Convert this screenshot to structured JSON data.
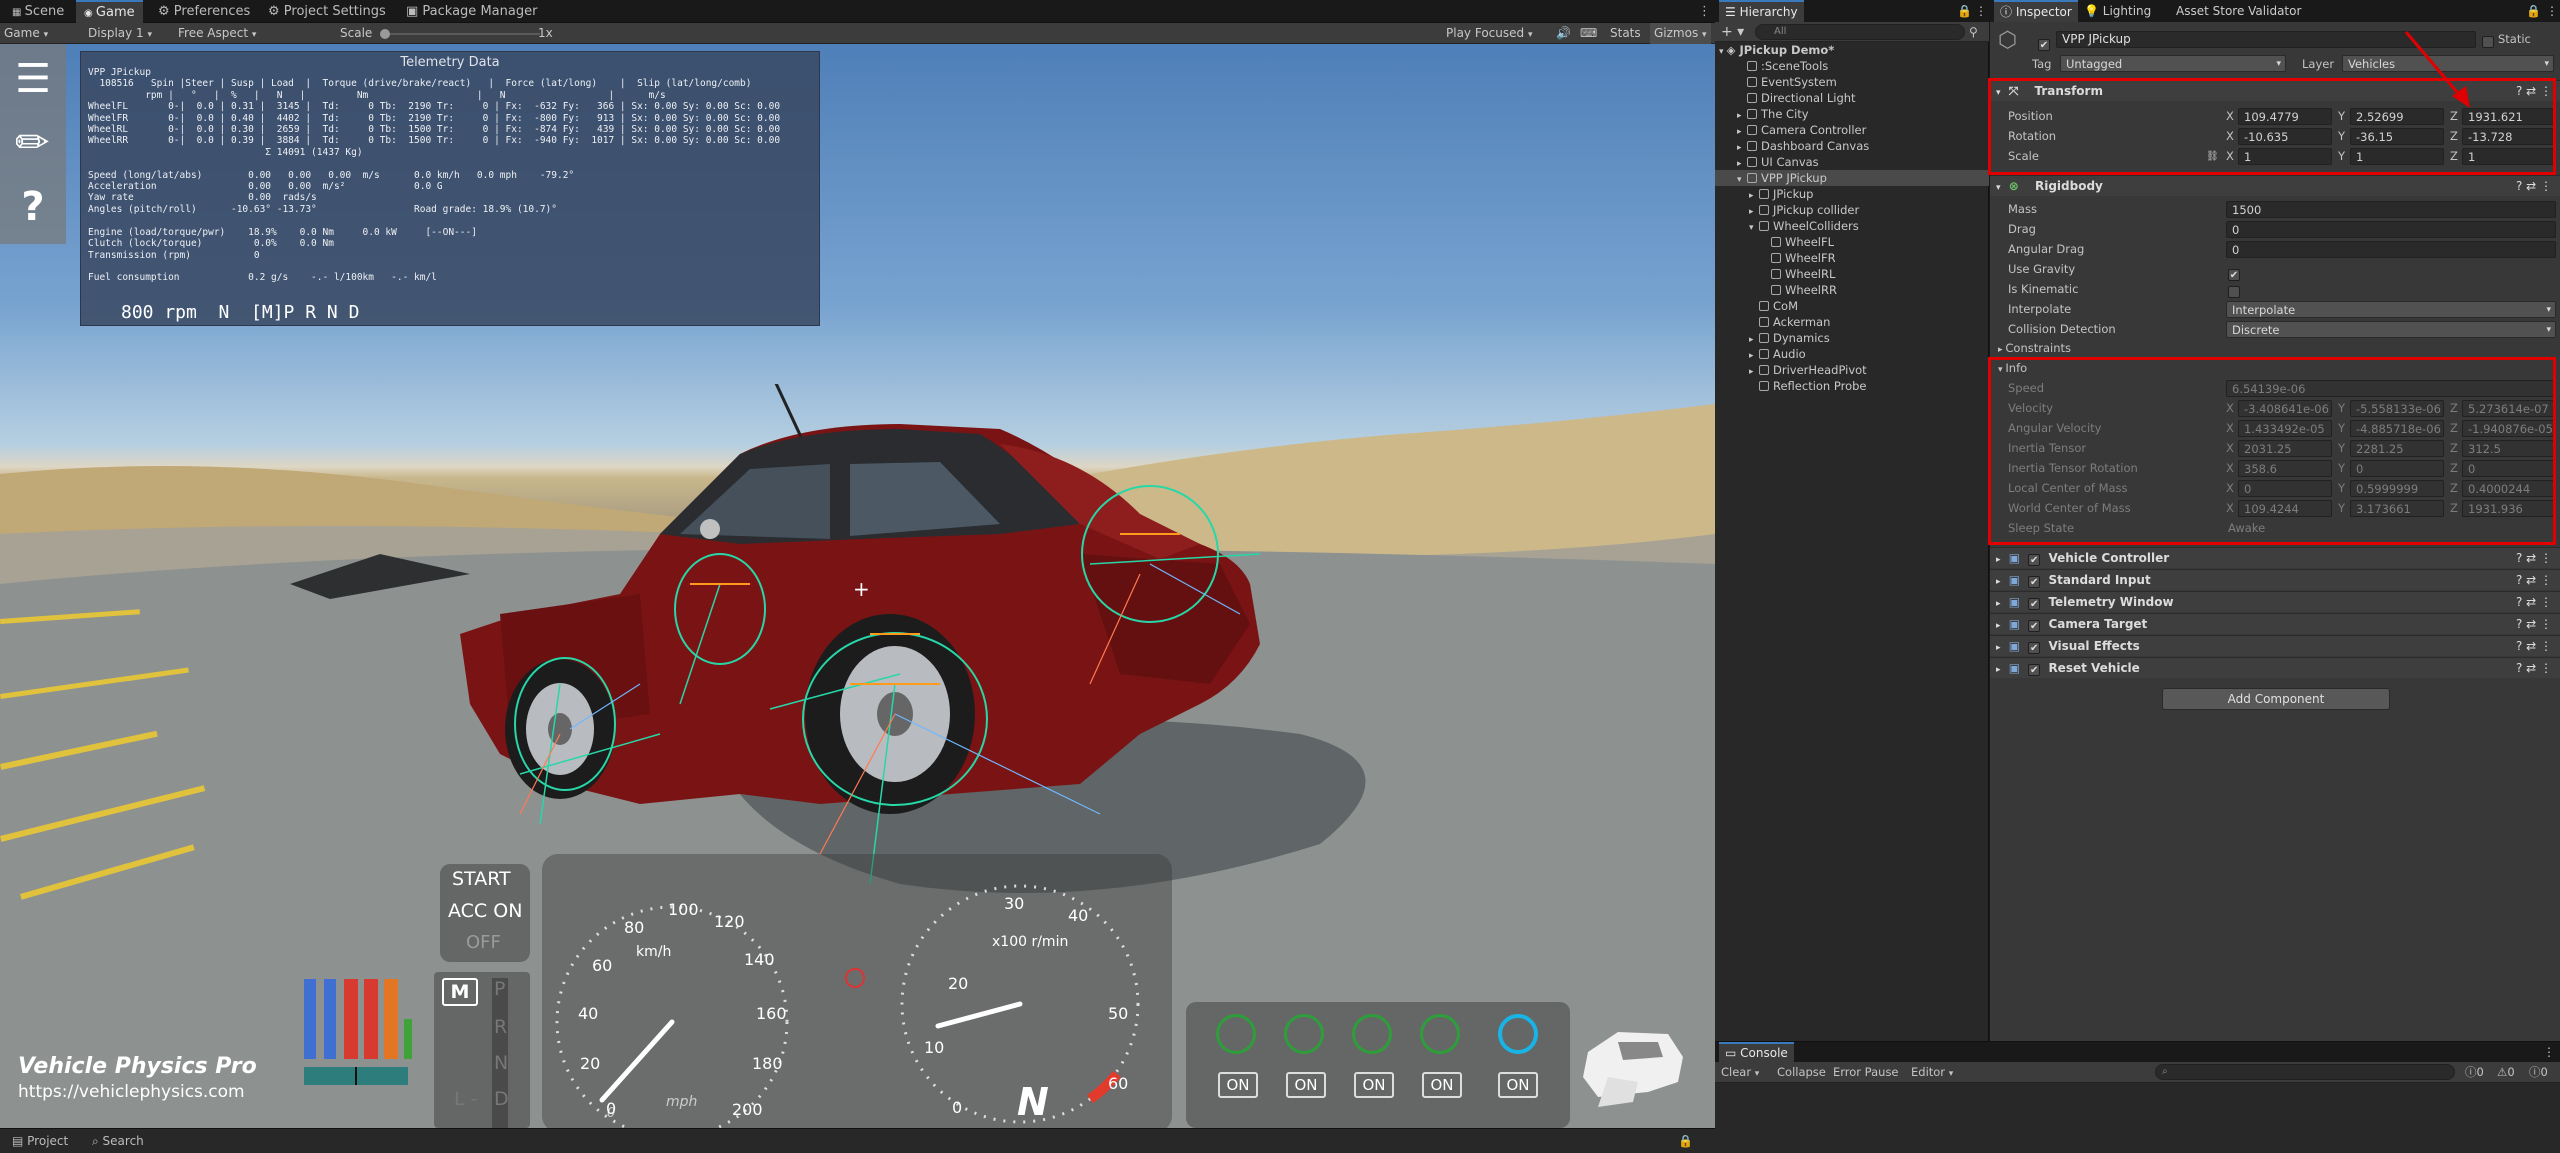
{
  "tabs": {
    "scene": "Scene",
    "game": "Game",
    "preferences": "Preferences",
    "project_settings": "Project Settings",
    "package_manager": "Package Manager"
  },
  "game_toolbar": {
    "game": "Game",
    "display": "Display 1",
    "aspect": "Free Aspect",
    "scale_label": "Scale",
    "scale_value": "1x",
    "play_mode": "Play Focused",
    "stats": "Stats",
    "gizmos": "Gizmos"
  },
  "telemetry": {
    "title": "Telemetry Data",
    "body": "VPP JPickup\n  108516   Spin |Steer | Susp | Load  |  Torque (drive/brake/react)   |  Force (lat/long)    |  Slip (lat/long/comb)\n          rpm |   °   |  %   |   N   |         Nm                   |   N                  |      m/s\nWheelFL       0-|  0.0 | 0.31 |  3145 |  Td:     0 Tb:  2190 Tr:     0 | Fx:  -632 Fy:   366 | Sx: 0.00 Sy: 0.00 Sc: 0.00\nWheelFR       0-|  0.0 | 0.40 |  4402 |  Td:     0 Tb:  2190 Tr:     0 | Fx:  -800 Fy:   913 | Sx: 0.00 Sy: 0.00 Sc: 0.00\nWheelRL       0-|  0.0 | 0.30 |  2659 |  Td:     0 Tb:  1500 Tr:     0 | Fx:  -874 Fy:   439 | Sx: 0.00 Sy: 0.00 Sc: 0.00\nWheelRR       0-|  0.0 | 0.39 |  3884 |  Td:     0 Tb:  1500 Tr:     0 | Fx:  -940 Fy:  1017 | Sx: 0.00 Sy: 0.00 Sc: 0.00\n                               Σ 14091 (1437 Kg)\n\nSpeed (long/lat/abs)        0.00   0.00   0.00  m/s      0.0 km/h   0.0 mph    -79.2°\nAcceleration                0.00   0.00  m/s²            0.0 G\nYaw rate                    0.00  rads/s\nAngles (pitch/roll)      -10.63° -13.73°                 Road grade: 18.9% (10.7)°\n\nEngine (load/torque/pwr)    18.9%    0.0 Nm     0.0 kW     [--ON---]\nClutch (lock/torque)         0.0%    0.0 Nm\nTransmission (rpm)           0\n\nFuel consumption            0.2 g/s    -.- l/100km   -.- km/l",
    "rpm_line": "800 rpm  N  [M]P R N D"
  },
  "hud": {
    "start": "START",
    "acc_on": "ACC ON",
    "off": "OFF",
    "gear_mode": "M",
    "gears": [
      "P",
      "R",
      "N",
      "D"
    ],
    "gear_l": "L -",
    "speedo_unit": "km/h",
    "speedo_labels": [
      "0",
      "20",
      "40",
      "60",
      "80",
      "100",
      "120",
      "140",
      "160",
      "180",
      "200"
    ],
    "speedo_mph": "0",
    "mph_label": "mph",
    "tacho_unit": "x100 r/min",
    "tacho_labels": [
      "0",
      "10",
      "20",
      "30",
      "40",
      "50",
      "60"
    ],
    "gear_display": "N",
    "assist_buttons": [
      "ON",
      "ON",
      "ON",
      "ON",
      "ON"
    ],
    "brand": "Vehicle Physics Pro",
    "url": "https://vehiclephysics.com"
  },
  "bottom_tabs": {
    "project": "Project",
    "search": "Search"
  },
  "hierarchy": {
    "tab": "Hierarchy",
    "search_placeholder": "All",
    "root": "JPickup Demo*",
    "items": [
      {
        "label": ":SceneTools",
        "indent": 1,
        "fold": ""
      },
      {
        "label": "EventSystem",
        "indent": 1,
        "fold": ""
      },
      {
        "label": "Directional Light",
        "indent": 1,
        "fold": ""
      },
      {
        "label": "The City",
        "indent": 1,
        "fold": "▸"
      },
      {
        "label": "Camera Controller",
        "indent": 1,
        "fold": "▸"
      },
      {
        "label": "Dashboard Canvas",
        "indent": 1,
        "fold": "▸"
      },
      {
        "label": "UI Canvas",
        "indent": 1,
        "fold": "▸"
      },
      {
        "label": "VPP JPickup",
        "indent": 1,
        "fold": "▾",
        "selected": true
      },
      {
        "label": "JPickup",
        "indent": 2,
        "fold": "▸"
      },
      {
        "label": "JPickup collider",
        "indent": 2,
        "fold": "▸"
      },
      {
        "label": "WheelColliders",
        "indent": 2,
        "fold": "▾"
      },
      {
        "label": "WheelFL",
        "indent": 3,
        "fold": ""
      },
      {
        "label": "WheelFR",
        "indent": 3,
        "fold": ""
      },
      {
        "label": "WheelRL",
        "indent": 3,
        "fold": ""
      },
      {
        "label": "WheelRR",
        "indent": 3,
        "fold": ""
      },
      {
        "label": "CoM",
        "indent": 2,
        "fold": ""
      },
      {
        "label": "Ackerman",
        "indent": 2,
        "fold": ""
      },
      {
        "label": "Dynamics",
        "indent": 2,
        "fold": "▸"
      },
      {
        "label": "Audio",
        "indent": 2,
        "fold": "▸"
      },
      {
        "label": "DriverHeadPivot",
        "indent": 2,
        "fold": "▸"
      },
      {
        "label": "Reflection Probe",
        "indent": 2,
        "fold": ""
      }
    ]
  },
  "inspector": {
    "tabs": {
      "inspector": "Inspector",
      "lighting": "Lighting",
      "asset_store": "Asset Store Validator"
    },
    "object_name": "VPP JPickup",
    "static_label": "Static",
    "tag_label": "Tag",
    "tag_value": "Untagged",
    "layer_label": "Layer",
    "layer_value": "Vehicles",
    "transform": {
      "title": "Transform",
      "rows": [
        {
          "label": "Position",
          "x": "109.4779",
          "y": "2.52699",
          "z": "1931.621"
        },
        {
          "label": "Rotation",
          "x": "-10.635",
          "y": "-36.15",
          "z": "-13.728"
        },
        {
          "label": "Scale",
          "x": "1",
          "y": "1",
          "z": "1"
        }
      ]
    },
    "rigidbody": {
      "title": "Rigidbody",
      "rows": [
        {
          "label": "Mass",
          "value": "1500",
          "type": "text"
        },
        {
          "label": "Drag",
          "value": "0",
          "type": "text"
        },
        {
          "label": "Angular Drag",
          "value": "0",
          "type": "text"
        },
        {
          "label": "Use Gravity",
          "value": "✔",
          "type": "check"
        },
        {
          "label": "Is Kinematic",
          "value": "",
          "type": "check"
        },
        {
          "label": "Interpolate",
          "value": "Interpolate",
          "type": "dropdown"
        },
        {
          "label": "Collision Detection",
          "value": "Discrete",
          "type": "dropdown"
        }
      ],
      "constraints": "Constraints"
    },
    "info": {
      "title": "Info",
      "speed_label": "Speed",
      "speed_value": "6.54139e-06",
      "rows": [
        {
          "label": "Velocity",
          "x": "-3.408641e-06",
          "y": "-5.558133e-06",
          "z": "5.273614e-07"
        },
        {
          "label": "Angular Velocity",
          "x": "1.433492e-05",
          "y": "-4.885718e-06",
          "z": "-1.940876e-05"
        },
        {
          "label": "Inertia Tensor",
          "x": "2031.25",
          "y": "2281.25",
          "z": "312.5"
        },
        {
          "label": "Inertia Tensor Rotation",
          "x": "358.6",
          "y": "0",
          "z": "0"
        },
        {
          "label": "Local Center of Mass",
          "x": "0",
          "y": "0.5999999",
          "z": "0.4000244"
        },
        {
          "label": "World Center of Mass",
          "x": "109.4244",
          "y": "3.173661",
          "z": "1931.936"
        }
      ],
      "sleep_label": "Sleep State",
      "sleep_value": "Awake"
    },
    "components": [
      "Vehicle Controller",
      "Standard Input",
      "Telemetry Window",
      "Camera Target",
      "Visual Effects",
      "Reset Vehicle"
    ],
    "add_component": "Add Component"
  },
  "console": {
    "tab": "Console",
    "clear": "Clear",
    "collapse": "Collapse",
    "error_pause": "Error Pause",
    "editor": "Editor",
    "counts": [
      "0",
      "0",
      "0"
    ]
  }
}
